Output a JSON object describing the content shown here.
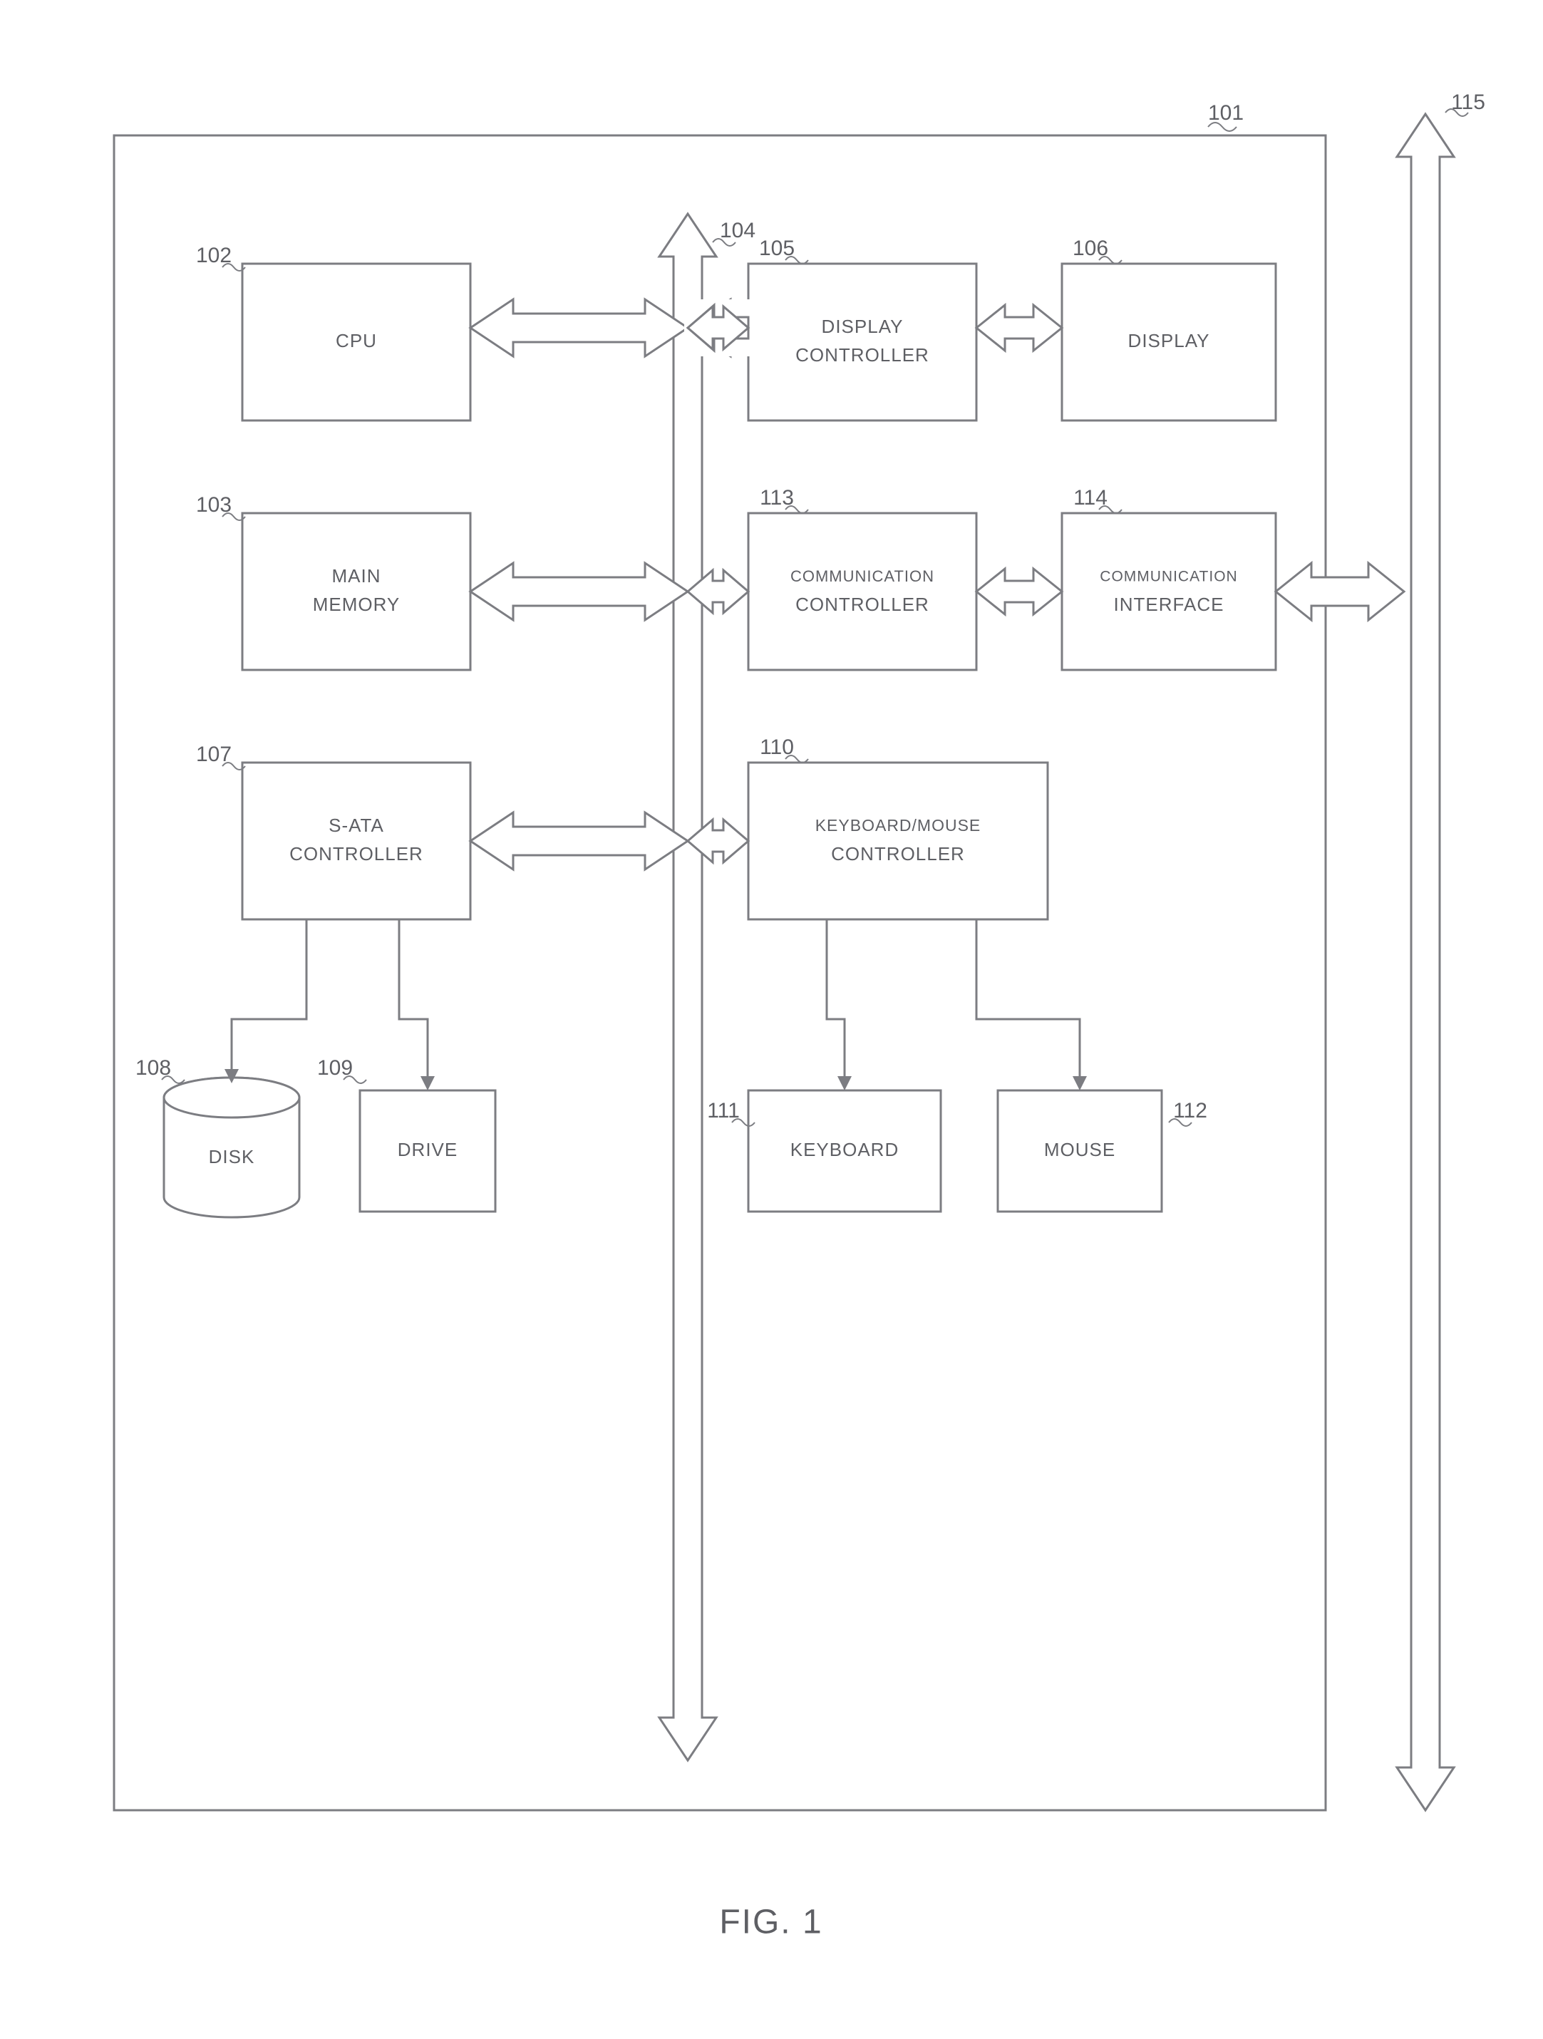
{
  "figure": "FIG. 1",
  "refs": {
    "r101": "101",
    "r102": "102",
    "r103": "103",
    "r104": "104",
    "r105": "105",
    "r106": "106",
    "r107": "107",
    "r108": "108",
    "r109": "109",
    "r110": "110",
    "r111": "111",
    "r112": "112",
    "r113": "113",
    "r114": "114",
    "r115": "115"
  },
  "blocks": {
    "cpu": "CPU",
    "main_memory_l1": "MAIN",
    "main_memory_l2": "MEMORY",
    "sata_l1": "S-ATA",
    "sata_l2": "CONTROLLER",
    "drive": "DRIVE",
    "disk": "DISK",
    "disp_ctrl_l1": "DISPLAY",
    "disp_ctrl_l2": "CONTROLLER",
    "display": "DISPLAY",
    "comm_ctrl_l1": "COMMUNICATION",
    "comm_ctrl_l2": "CONTROLLER",
    "comm_if_l1": "COMMUNICATION",
    "comm_if_l2": "INTERFACE",
    "kbm_l1": "KEYBOARD/MOUSE",
    "kbm_l2": "CONTROLLER",
    "keyboard": "KEYBOARD",
    "mouse": "MOUSE"
  },
  "chart_data": {
    "type": "diagram",
    "title": "FIG. 1",
    "container": {
      "ref": "101"
    },
    "nodes": [
      {
        "id": "cpu",
        "label": "CPU",
        "ref": "102",
        "shape": "rect"
      },
      {
        "id": "main_memory",
        "label": "MAIN MEMORY",
        "ref": "103",
        "shape": "rect"
      },
      {
        "id": "bus",
        "label": "",
        "ref": "104",
        "shape": "bus"
      },
      {
        "id": "disp_ctrl",
        "label": "DISPLAY CONTROLLER",
        "ref": "105",
        "shape": "rect"
      },
      {
        "id": "display",
        "label": "DISPLAY",
        "ref": "106",
        "shape": "rect"
      },
      {
        "id": "sata",
        "label": "S-ATA CONTROLLER",
        "ref": "107",
        "shape": "rect"
      },
      {
        "id": "disk",
        "label": "DISK",
        "ref": "108",
        "shape": "cylinder"
      },
      {
        "id": "drive",
        "label": "DRIVE",
        "ref": "109",
        "shape": "rect"
      },
      {
        "id": "kbm",
        "label": "KEYBOARD/MOUSE CONTROLLER",
        "ref": "110",
        "shape": "rect"
      },
      {
        "id": "keyboard",
        "label": "KEYBOARD",
        "ref": "111",
        "shape": "rect"
      },
      {
        "id": "mouse",
        "label": "MOUSE",
        "ref": "112",
        "shape": "rect"
      },
      {
        "id": "comm_ctrl",
        "label": "COMMUNICATION CONTROLLER",
        "ref": "113",
        "shape": "rect"
      },
      {
        "id": "comm_if",
        "label": "COMMUNICATION INTERFACE",
        "ref": "114",
        "shape": "rect"
      },
      {
        "id": "ext_bus",
        "label": "",
        "ref": "115",
        "shape": "bus"
      }
    ],
    "edges": [
      {
        "from": "cpu",
        "to": "bus",
        "style": "double-arrow"
      },
      {
        "from": "main_memory",
        "to": "bus",
        "style": "double-arrow"
      },
      {
        "from": "sata",
        "to": "bus",
        "style": "double-arrow"
      },
      {
        "from": "disp_ctrl",
        "to": "bus",
        "style": "double-arrow"
      },
      {
        "from": "comm_ctrl",
        "to": "bus",
        "style": "double-arrow"
      },
      {
        "from": "kbm",
        "to": "bus",
        "style": "double-arrow"
      },
      {
        "from": "disp_ctrl",
        "to": "display",
        "style": "double-arrow"
      },
      {
        "from": "comm_ctrl",
        "to": "comm_if",
        "style": "double-arrow"
      },
      {
        "from": "comm_if",
        "to": "ext_bus",
        "style": "double-arrow"
      },
      {
        "from": "sata",
        "to": "disk",
        "style": "line-arrow"
      },
      {
        "from": "sata",
        "to": "drive",
        "style": "line-arrow"
      },
      {
        "from": "kbm",
        "to": "keyboard",
        "style": "line-arrow"
      },
      {
        "from": "kbm",
        "to": "mouse",
        "style": "line-arrow"
      }
    ]
  }
}
